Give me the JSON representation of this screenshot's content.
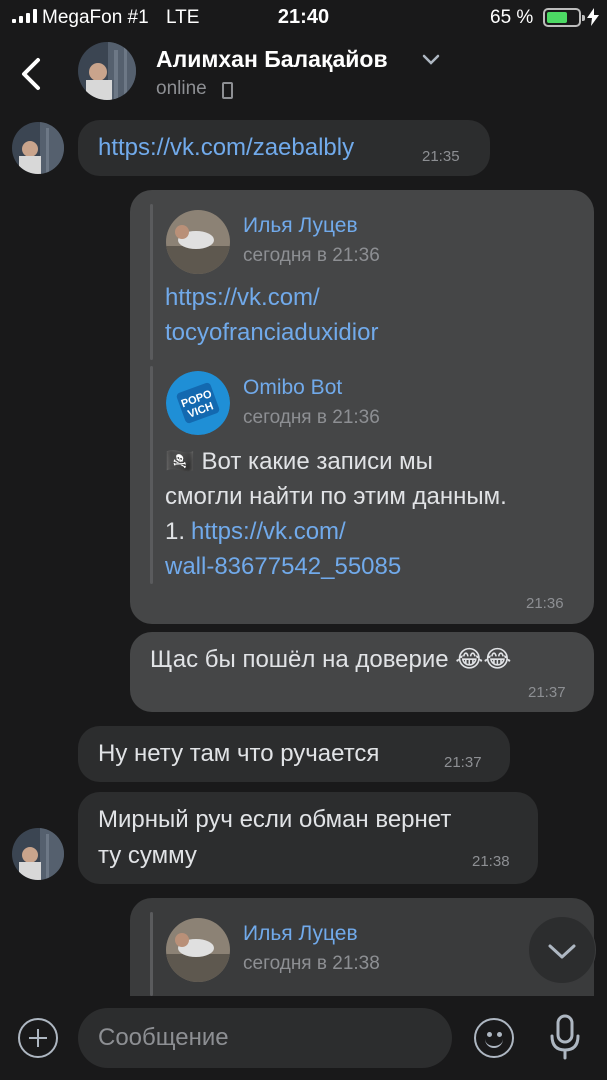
{
  "status_bar": {
    "carrier": "MegaFon #1",
    "network": "LTE",
    "time": "21:40",
    "battery_percent": "65 %",
    "battery_level": 0.65,
    "battery_color": "#4cd964"
  },
  "header": {
    "contact_name": "Алимхан Балақайов",
    "status": "online"
  },
  "messages": [
    {
      "direction": "incoming",
      "text": "https://vk.com/zaebalbly",
      "time": "21:35"
    },
    {
      "direction": "outgoing",
      "time": "21:36",
      "forwarded": [
        {
          "author": "Илья Луцев",
          "date": "сегодня в 21:36",
          "lines": [
            "https://vk.com/",
            "tocyofranciaduxidior"
          ]
        },
        {
          "author": "Omibo Bot",
          "date": "сегодня в 21:36",
          "lines": [
            "🏴‍☠️ Вот какие записи мы",
            "смогли найти по этим данным.",
            "1. ",
            "https://vk.com/",
            "wall-83677542_55085"
          ]
        }
      ]
    },
    {
      "direction": "outgoing",
      "text": "Щас бы пошёл на доверие 😂😂",
      "time": "21:37"
    },
    {
      "direction": "incoming",
      "text": "Ну нету там что ручается",
      "time": "21:37"
    },
    {
      "direction": "incoming",
      "lines": [
        "Мирный руч если обман вернет",
        "ту сумму"
      ],
      "time": "21:38"
    },
    {
      "direction": "outgoing",
      "forwarded": [
        {
          "author": "Илья Луцев",
          "date": "сегодня в 21:38"
        }
      ]
    }
  ],
  "composer": {
    "placeholder": "Сообщение"
  },
  "colors": {
    "link": "#71aaeb",
    "background": "#19191a",
    "incoming_bubble": "#2c2d2e",
    "outgoing_bubble": "#454647"
  },
  "icons": [
    "back-arrow-icon",
    "chevron-down-icon",
    "phone-icon",
    "plus-icon",
    "emoji-icon",
    "microphone-icon",
    "scroll-down-icon"
  ]
}
